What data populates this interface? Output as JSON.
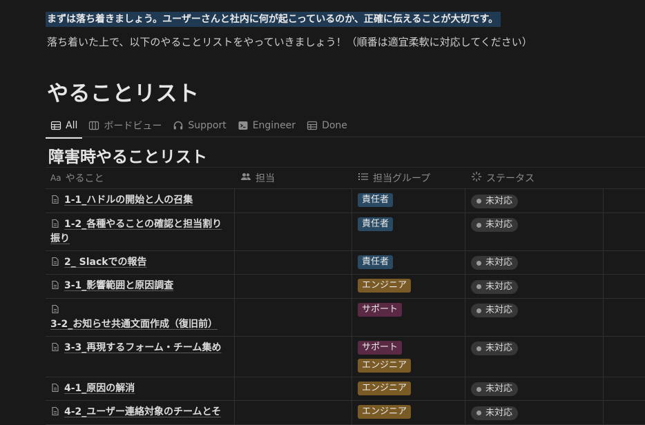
{
  "intro": {
    "highlight": "まずは落ち着きましょう。ユーザーさんと社内に何が起こっているのか、正確に伝えることが大切です。",
    "subtext": "落ち着いた上で、以下のやることリストをやっていきましょう！（順番は適宜柔軟に対応してください）"
  },
  "page_title": "やることリスト",
  "tabs": [
    {
      "label": "All",
      "icon": "table-icon",
      "active": true
    },
    {
      "label": "ボードビュー",
      "icon": "board-icon",
      "active": false
    },
    {
      "label": "Support",
      "icon": "headset-icon",
      "active": false
    },
    {
      "label": "Engineer",
      "icon": "terminal-icon",
      "active": false
    },
    {
      "label": "Done",
      "icon": "table-icon",
      "active": false
    }
  ],
  "database_title": "障害時やることリスト",
  "columns": {
    "name": {
      "label": "やること",
      "icon": "aa-icon"
    },
    "assignee": {
      "label": "担当",
      "icon": "people-icon"
    },
    "group": {
      "label": "担当グループ",
      "icon": "list-icon"
    },
    "status": {
      "label": "ステータス",
      "icon": "spinner-icon"
    }
  },
  "tag_colors": {
    "責任者": "#2a4a64",
    "エンジニア": "#7a5b26",
    "サポート": "#5a2a44"
  },
  "rows": [
    {
      "name": "1-1_ハドルの開始と人の召集",
      "groups": [
        "責任者"
      ],
      "status": "未対応"
    },
    {
      "name": "1-2_各種やることの確認と担当割り振り",
      "groups": [
        "責任者"
      ],
      "status": "未対応"
    },
    {
      "name": "2_ Slackでの報告",
      "groups": [
        "責任者"
      ],
      "status": "未対応"
    },
    {
      "name": "3-1_影響範囲と原因調査",
      "groups": [
        "エンジニア"
      ],
      "status": "未対応"
    },
    {
      "name": "3-2_お知らせ共通文面作成（復旧前）",
      "groups": [
        "サポート"
      ],
      "status": "未対応"
    },
    {
      "name": "3-3_再現するフォーム・チーム集め",
      "groups": [
        "サポート",
        "エンジニア"
      ],
      "status": "未対応"
    },
    {
      "name": "4-1_原因の解消",
      "groups": [
        "エンジニア"
      ],
      "status": "未対応"
    },
    {
      "name": "4-2_ユーザー連絡対象のチームとそ",
      "groups": [
        "エンジニア"
      ],
      "status": "未対応"
    }
  ]
}
